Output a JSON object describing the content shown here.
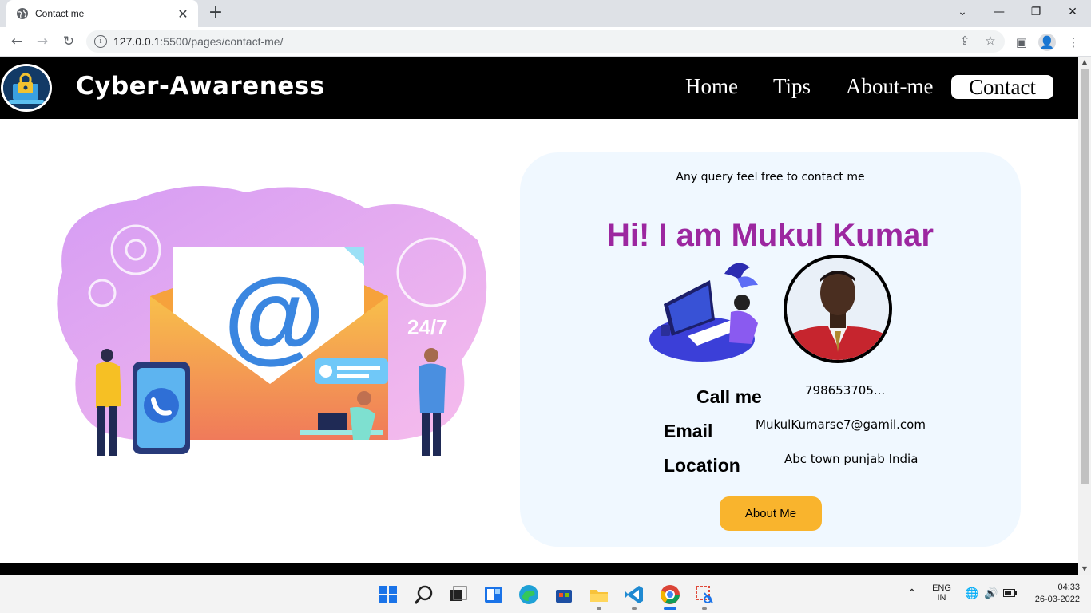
{
  "browser": {
    "tab_title": "Contact me",
    "new_tab_symbol": "+",
    "url_host": "127.0.0.1",
    "url_rest": ":5500/pages/contact-me/"
  },
  "site": {
    "brand": "Cyber-Awareness",
    "nav": [
      "Home",
      "Tips",
      "About-me"
    ],
    "nav_active": "Contact"
  },
  "card": {
    "query_text": "Any query feel free to contact me",
    "heading": "Hi! I am Mukul Kumar",
    "call_label": "Call me",
    "call_value": "798653705...",
    "email_label": "Email",
    "email_value": "MukulKumarse7@gamil.com",
    "location_label": "Location",
    "location_value": "Abc town punjab India",
    "button_label": "About Me",
    "accent_color": "#9c27a0",
    "button_color": "#f9b42d",
    "card_bg": "#f0f8ff"
  },
  "illustration": {
    "badge_text": "24/7",
    "at_symbol": "@"
  },
  "taskbar": {
    "lang_line1": "ENG",
    "lang_line2": "IN",
    "time": "04:33",
    "date": "26-03-2022"
  }
}
